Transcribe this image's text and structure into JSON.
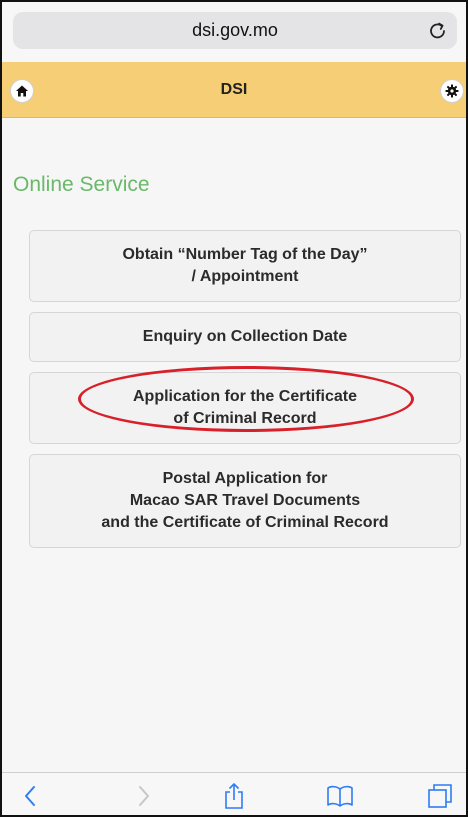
{
  "browser": {
    "url": "dsi.gov.mo"
  },
  "header": {
    "title": "DSI",
    "left_icon": "home-icon",
    "right_icon": "gear-icon"
  },
  "main": {
    "section_title": "Online Service",
    "services": [
      {
        "label": "Obtain “Number Tag of the Day”\n/ Appointment"
      },
      {
        "label": "Enquiry on Collection Date"
      },
      {
        "label": "Application for the Certificate\nof Criminal Record"
      },
      {
        "label": "Postal Application for\nMacao SAR Travel Documents\nand the Certificate of Criminal Record"
      }
    ]
  },
  "toolbar": {
    "icons": [
      "back-icon",
      "forward-icon",
      "share-icon",
      "bookmarks-icon",
      "tabs-icon"
    ]
  },
  "colors": {
    "header_bg": "#f6ce75",
    "section_title": "#6ab86a",
    "highlight": "#d8202a",
    "ios_blue": "#2f7cf6"
  }
}
